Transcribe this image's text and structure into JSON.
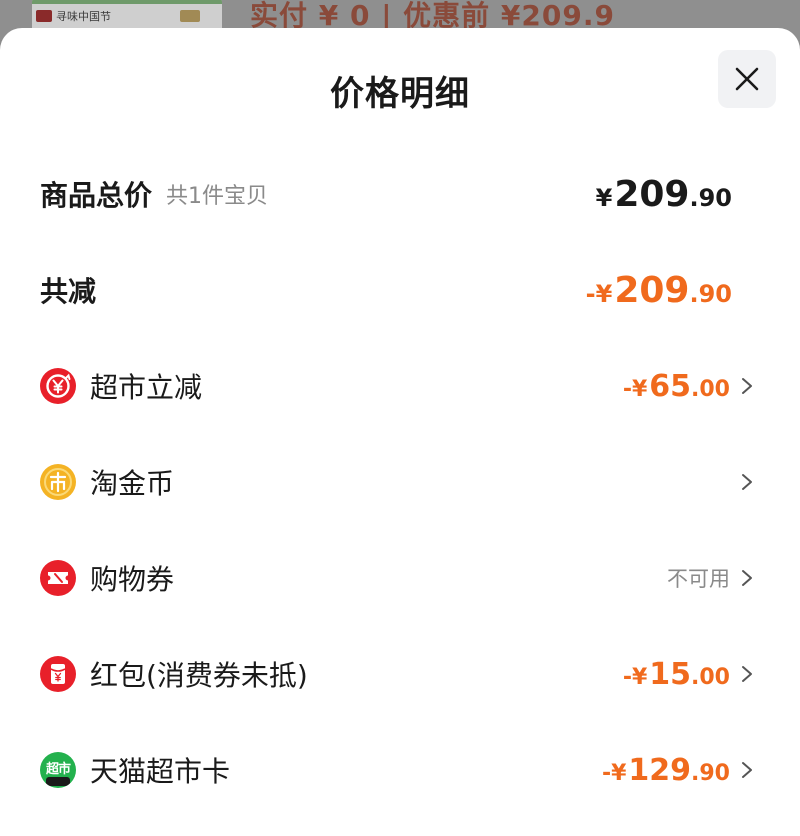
{
  "behind": {
    "thumb_text": "寻味中国节",
    "pay_text": "实付 ¥ 0 | 优惠前 ¥209.9"
  },
  "sheet": {
    "title": "价格明细"
  },
  "total": {
    "label": "商品总价",
    "sub": "共1件宝贝",
    "yen": "¥",
    "int": "209",
    "dec": ".90"
  },
  "reduce": {
    "label": "共减",
    "yen": "-¥",
    "int": "209",
    "dec": ".90"
  },
  "items": [
    {
      "label": "超市立减",
      "icon": "yen-circle-icon",
      "yen": "-¥",
      "int": "65",
      "dec": ".00"
    },
    {
      "label": "淘金币",
      "icon": "coin-icon"
    },
    {
      "label": "购物券",
      "icon": "ticket-icon",
      "status": "不可用"
    },
    {
      "label": "红包(消费券未抵)",
      "icon": "red-packet-icon",
      "yen": "-¥",
      "int": "15",
      "dec": ".00"
    },
    {
      "label": "天猫超市卡",
      "icon": "tmall-supermarket-icon",
      "icon_text": "超市",
      "yen": "-¥",
      "int": "129",
      "dec": ".90"
    }
  ],
  "colors": {
    "accent": "#f06a1d",
    "red_icon": "#e8202a",
    "coin": "#f4b324",
    "tmall_green": "#23b14d"
  }
}
